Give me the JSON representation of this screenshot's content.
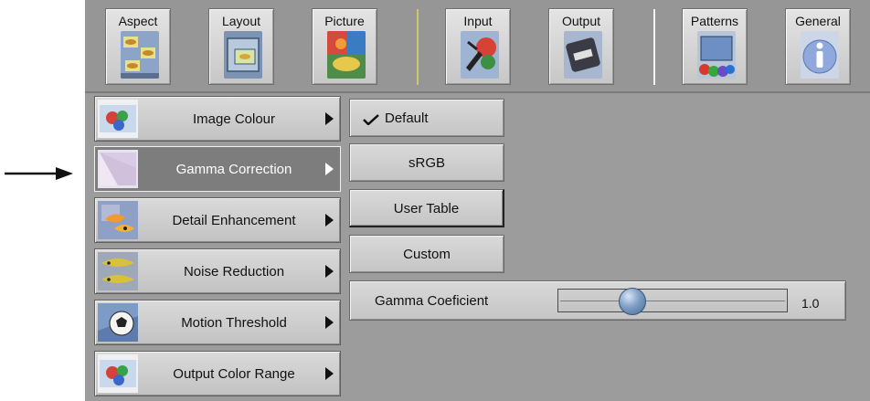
{
  "toolbar": {
    "buttons": [
      {
        "label": "Aspect",
        "icon": "aspect-icon"
      },
      {
        "label": "Layout",
        "icon": "layout-icon"
      },
      {
        "label": "Picture",
        "icon": "picture-icon"
      },
      {
        "label": "Input",
        "icon": "input-icon"
      },
      {
        "label": "Output",
        "icon": "output-icon"
      },
      {
        "label": "Patterns",
        "icon": "patterns-icon"
      },
      {
        "label": "General",
        "icon": "general-info-icon"
      }
    ]
  },
  "side_menu": {
    "items": [
      {
        "label": "Image Colour",
        "icon": "image-colour-icon",
        "active": false
      },
      {
        "label": "Gamma Correction",
        "icon": "gamma-correction-icon",
        "active": true
      },
      {
        "label": "Detail Enhancement",
        "icon": "detail-enhancement-icon",
        "active": false
      },
      {
        "label": "Noise Reduction",
        "icon": "noise-reduction-icon",
        "active": false
      },
      {
        "label": "Motion Threshold",
        "icon": "motion-threshold-icon",
        "active": false
      },
      {
        "label": "Output Color Range",
        "icon": "output-color-range-icon",
        "active": false
      }
    ]
  },
  "gamma_options": {
    "items": [
      {
        "label": "Default",
        "checked": true
      },
      {
        "label": "sRGB",
        "checked": false
      },
      {
        "label": "User Table",
        "checked": false
      },
      {
        "label": "Custom",
        "checked": false
      }
    ]
  },
  "gamma_coefficient": {
    "label": "Gamma Coeficient",
    "value": "1.0",
    "position_fraction": 0.32
  },
  "colors": {
    "panel_bg": "#9c9c9c",
    "active_item_bg": "#7d7d7d",
    "button_bg": "#cfcfcf",
    "knob": "#6f90b8"
  }
}
